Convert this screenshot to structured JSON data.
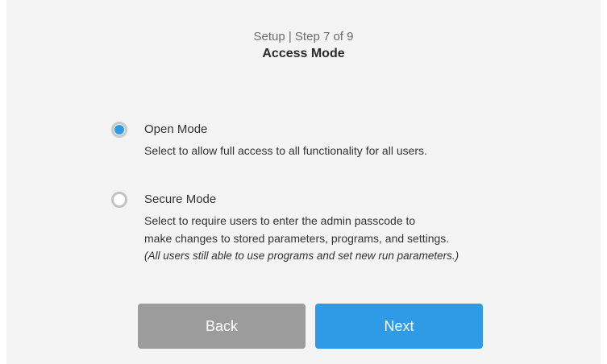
{
  "header": {
    "step_text": "Setup | Step 7 of 9",
    "title": "Access Mode"
  },
  "options": [
    {
      "label": "Open Mode",
      "selected": true,
      "description_lines": [
        "Select to allow full access to all functionality for all users."
      ]
    },
    {
      "label": "Secure Mode",
      "selected": false,
      "description_lines": [
        "Select to require users to enter the admin passcode to",
        "make changes to stored parameters, programs, and settings."
      ],
      "note": "(All users still able to use programs and set new run parameters.)"
    }
  ],
  "buttons": {
    "back_label": "Back",
    "next_label": "Next"
  },
  "colors": {
    "accent": "#2f9be7",
    "back_button": "#9c9c9c",
    "background": "#f4f4f4"
  }
}
